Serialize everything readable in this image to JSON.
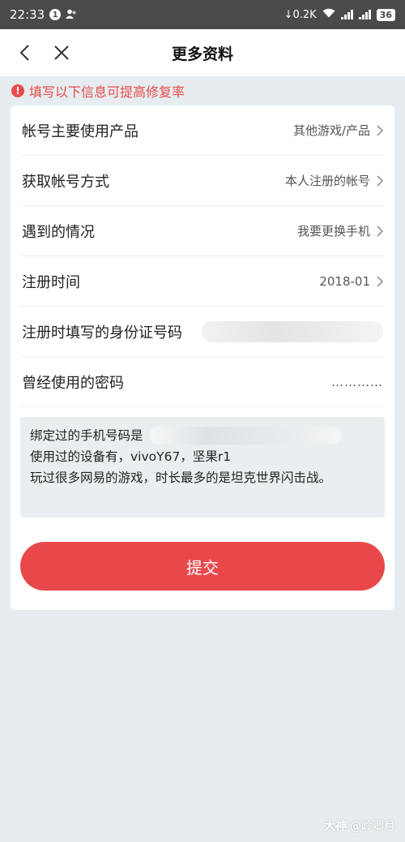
{
  "status_bar": {
    "time": "22:33",
    "notification_count": "1",
    "net_speed": "0.2K",
    "battery": "36"
  },
  "nav": {
    "title": "更多资料"
  },
  "hint": {
    "text": "填写以下信息可提高修复率",
    "icon_glyph": "!"
  },
  "form": {
    "rows": [
      {
        "label": "帐号主要使用产品",
        "value": "其他游戏/产品"
      },
      {
        "label": "获取帐号方式",
        "value": "本人注册的帐号"
      },
      {
        "label": "遇到的情况",
        "value": "我要更换手机"
      },
      {
        "label": "注册时间",
        "value": "2018-01"
      },
      {
        "label": "注册时填写的身份证号码"
      },
      {
        "label": "曾经使用的密码",
        "value": "…………"
      }
    ],
    "note_lines": [
      "绑定过的手机号码是",
      "使用过的设备有，vivoY67，坚果r1",
      "玩过很多网易的游戏，时长最多的是坦克世界闪击战。"
    ],
    "submit_label": "提交"
  },
  "watermark": {
    "brand": "大神",
    "user": "@岭卿月"
  },
  "colors": {
    "accent": "#e9484a",
    "background": "#e6ecef",
    "hint": "#e74c4c"
  }
}
